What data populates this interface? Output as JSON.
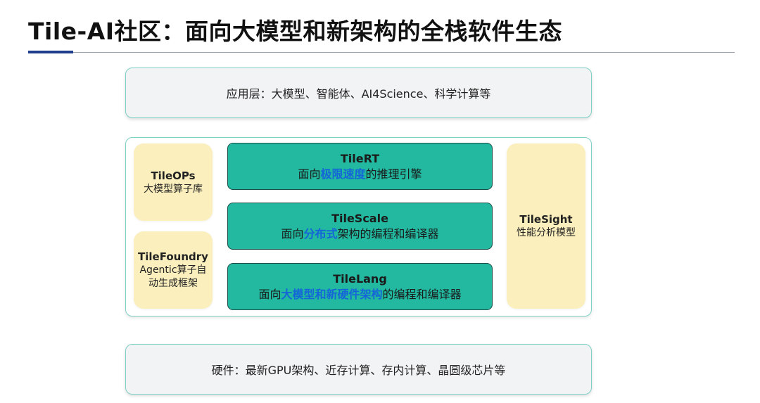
{
  "title": "Tile-AI社区：面向大模型和新架构的全栈软件生态",
  "app_layer": {
    "text": "应用层：大模型、智能体、AI4Science、科学计算等"
  },
  "hardware_layer": {
    "text": "硬件：最新GPU架构、近存计算、存内计算、晶圆级芯片等"
  },
  "tileops": {
    "title": "TileOPs",
    "subtitle": "大模型算子库"
  },
  "tilefoundry": {
    "title": "TileFoundry",
    "subtitle": "Agentic算子自动生成框架"
  },
  "tilesight": {
    "title": "TileSight",
    "subtitle": "性能分析模型"
  },
  "tilert": {
    "title": "TileRT",
    "pre": "面向",
    "highlight": "极限速度",
    "post": "的推理引擎"
  },
  "tilescale": {
    "title": "TileScale",
    "pre": "面向",
    "highlight": "分布式",
    "post": "架构的编程和编译器"
  },
  "tilelang": {
    "title": "TileLang",
    "pre": "面向",
    "highlight": "大模型和新硬件架构",
    "post": "的编程和编译器"
  },
  "colors": {
    "accent": "#1f3f8c",
    "layer_border": "#7fd0c6",
    "core_fill": "#22b9a0",
    "side_fill": "#fbefbd",
    "highlight": "#1565d8"
  }
}
